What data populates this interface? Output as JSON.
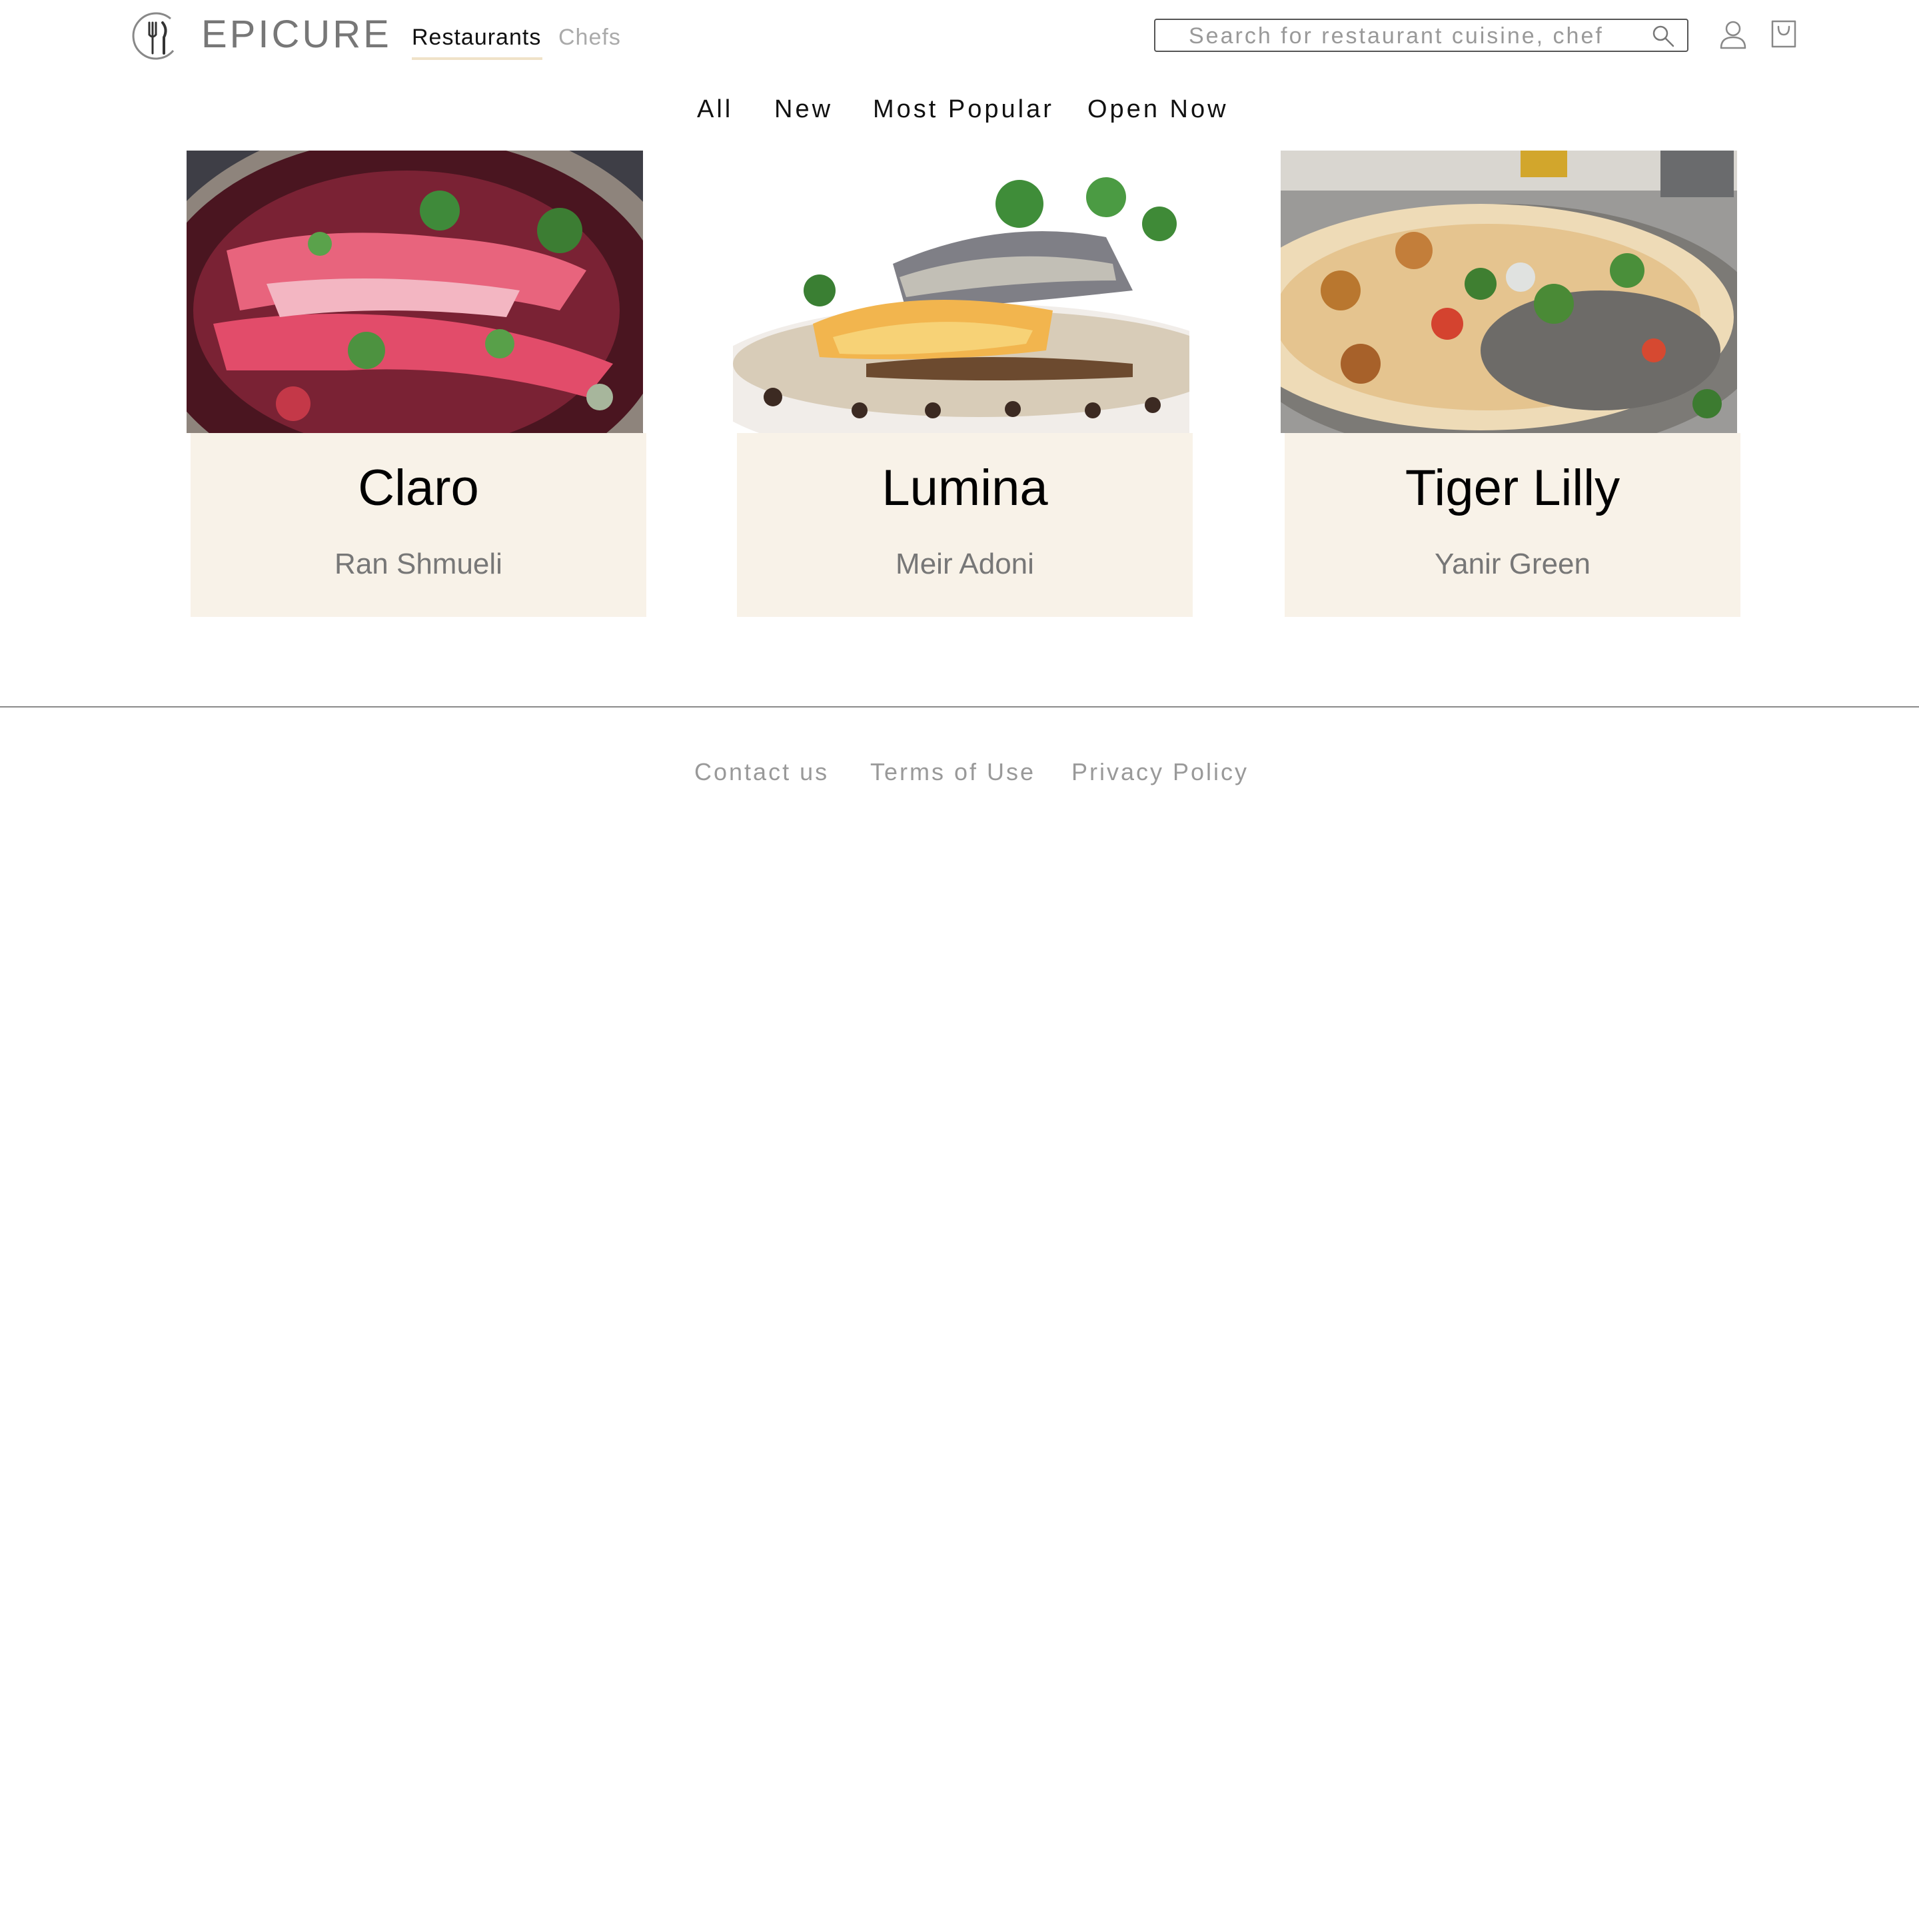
{
  "header": {
    "brand": "EPICURE",
    "tabs": [
      {
        "label": "Restaurants",
        "active": true
      },
      {
        "label": "Chefs",
        "active": false
      }
    ],
    "search": {
      "placeholder": "Search for restaurant cuisine, chef",
      "value": ""
    },
    "icons": {
      "logo": "fork-knife-logo",
      "search": "search-icon",
      "user": "user-icon",
      "cart": "shopping-bag-icon"
    }
  },
  "filters": [
    "All",
    "New",
    "Most Popular",
    "Open Now"
  ],
  "restaurants": [
    {
      "name": "Claro",
      "chef": "Ran Shmueli"
    },
    {
      "name": "Lumina",
      "chef": "Meir Adoni"
    },
    {
      "name": "Tiger Lilly",
      "chef": "Yanir Green"
    }
  ],
  "footer": {
    "links": [
      "Contact us",
      "Terms of Use",
      "Privacy Policy"
    ]
  },
  "colors": {
    "card_background": "#f8f2e8",
    "active_tab_underline": "#f0e2c8",
    "muted_text": "#999999",
    "divider": "#8a8a8a"
  }
}
